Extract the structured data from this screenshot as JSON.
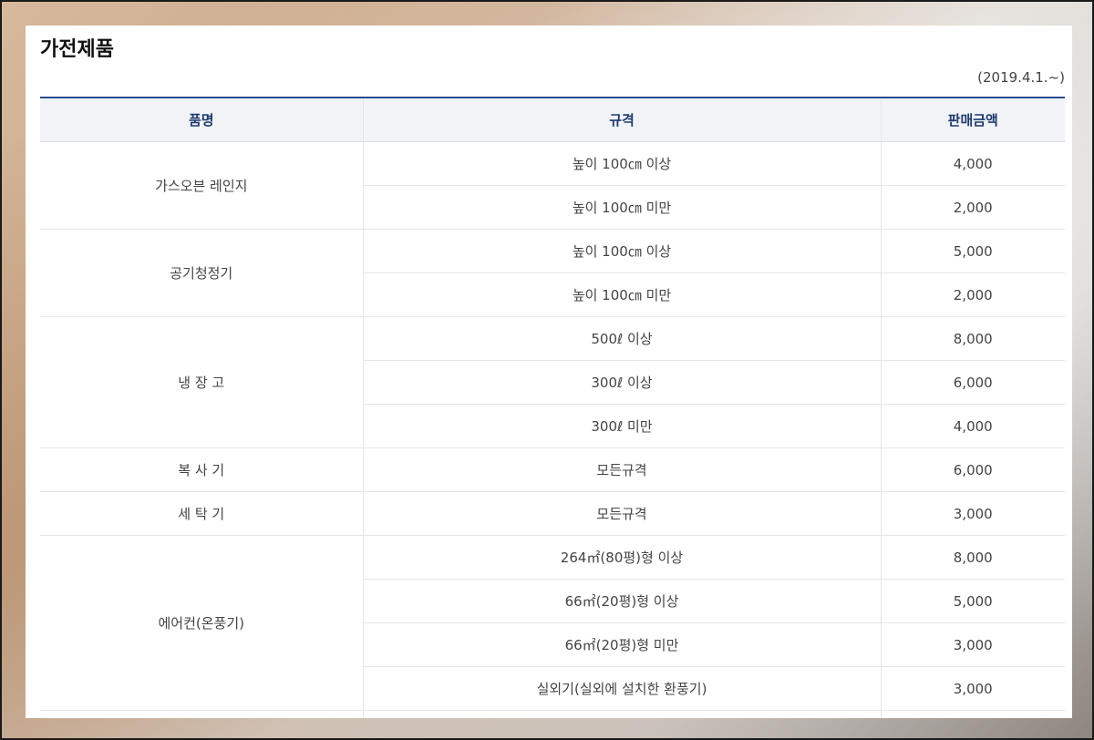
{
  "page": {
    "title": "가전제품",
    "effective_date": "(2019.4.1.~)"
  },
  "table": {
    "headers": [
      "품명",
      "규격",
      "판매금액"
    ],
    "groups": [
      {
        "name": "가스오븐 레인지",
        "rows": [
          {
            "spec": "높이 100㎝ 이상",
            "price": "4,000"
          },
          {
            "spec": "높이 100㎝ 미만",
            "price": "2,000"
          }
        ]
      },
      {
        "name": "공기청정기",
        "rows": [
          {
            "spec": "높이 100㎝ 이상",
            "price": "5,000"
          },
          {
            "spec": "높이 100㎝ 미만",
            "price": "2,000"
          }
        ]
      },
      {
        "name": "냉 장 고",
        "rows": [
          {
            "spec": "500ℓ 이상",
            "price": "8,000"
          },
          {
            "spec": "300ℓ 이상",
            "price": "6,000"
          },
          {
            "spec": "300ℓ 미만",
            "price": "4,000"
          }
        ]
      },
      {
        "name": "복 사 기",
        "rows": [
          {
            "spec": "모든규격",
            "price": "6,000"
          }
        ]
      },
      {
        "name": "세 탁 기",
        "rows": [
          {
            "spec": "모든규격",
            "price": "3,000"
          }
        ]
      },
      {
        "name": "에어컨(온풍기)",
        "rows": [
          {
            "spec": "264㎡(80평)형 이상",
            "price": "8,000"
          },
          {
            "spec": "66㎡(20평)형 이상",
            "price": "5,000"
          },
          {
            "spec": "66㎡(20평)형 미만",
            "price": "3,000"
          },
          {
            "spec": "실외기(실외에 설치한 환풍기)",
            "price": "3,000"
          }
        ]
      },
      {
        "name": "",
        "rows": [
          {
            "spec": "",
            "price": ""
          }
        ]
      }
    ]
  }
}
